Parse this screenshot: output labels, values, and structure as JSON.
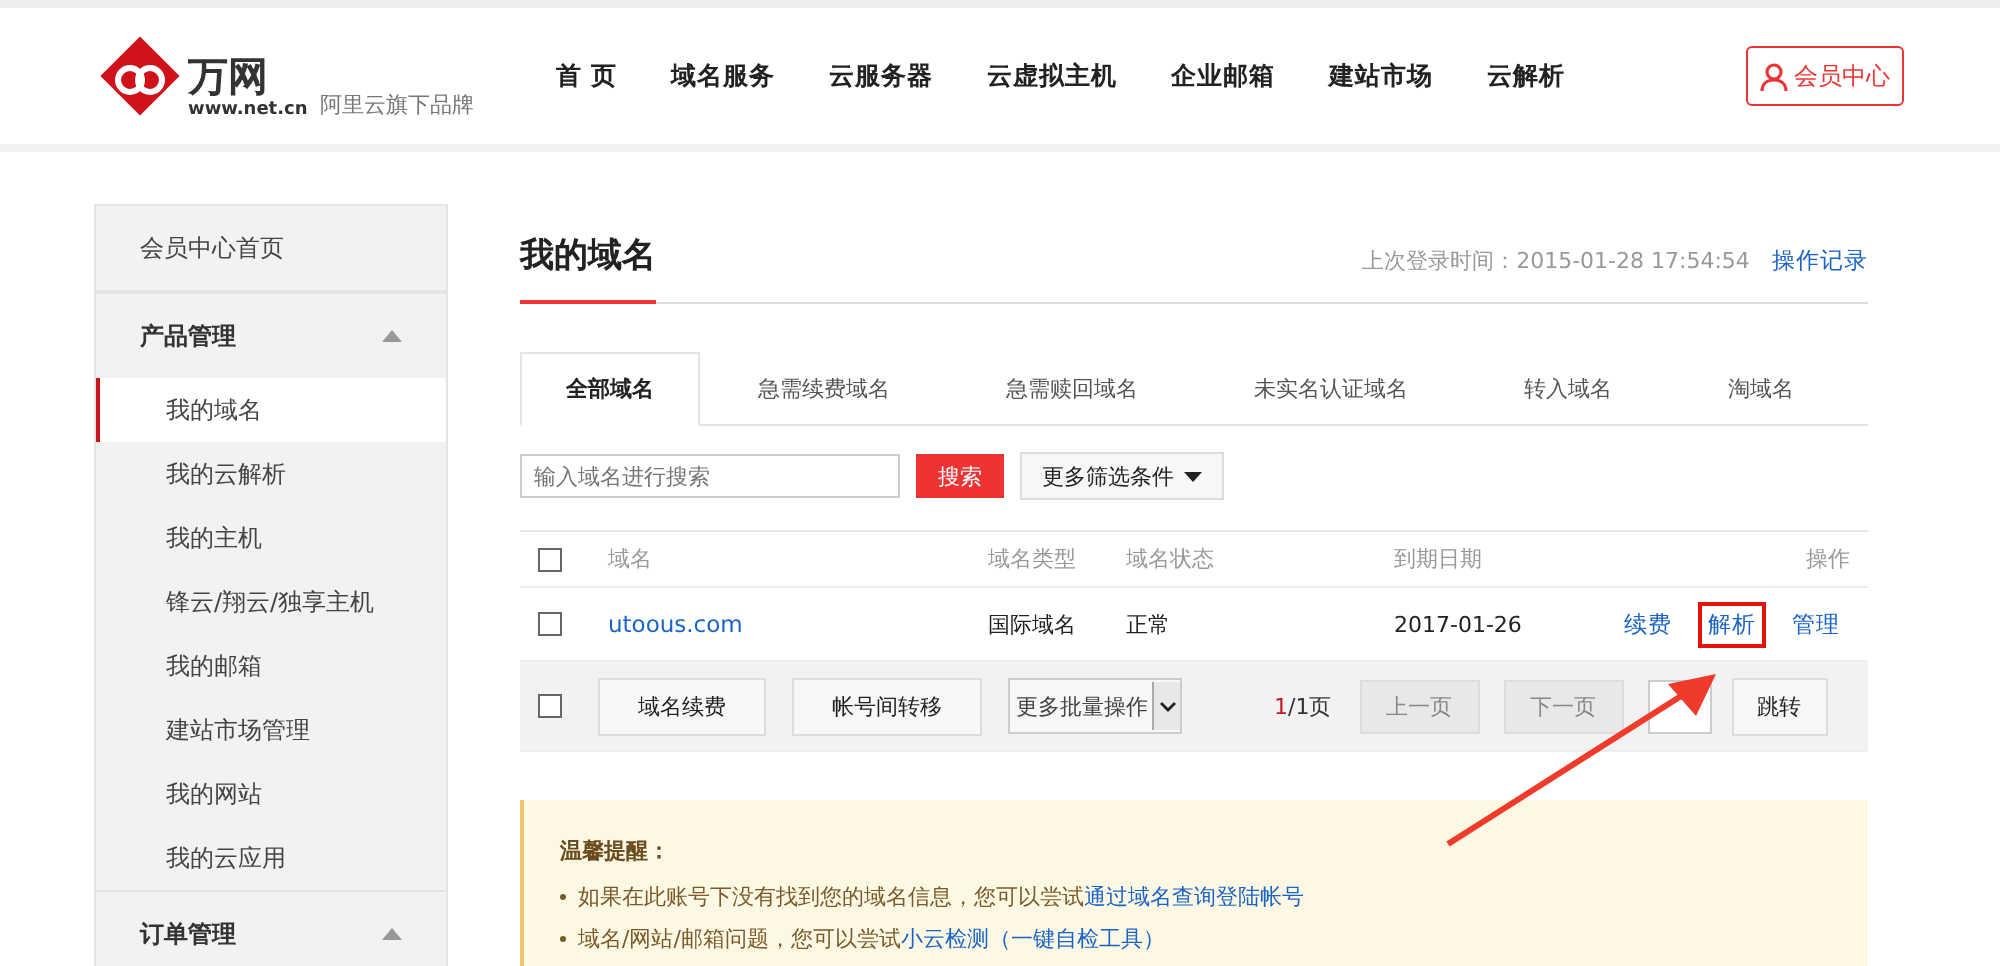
{
  "header": {
    "logo_name": "万网",
    "logo_url": "www.net.cn",
    "tagline": "阿里云旗下品牌",
    "nav": [
      {
        "label": "首 页"
      },
      {
        "label": "域名服务"
      },
      {
        "label": "云服务器"
      },
      {
        "label": "云虚拟主机"
      },
      {
        "label": "企业邮箱"
      },
      {
        "label": "建站市场"
      },
      {
        "label": "云解析"
      }
    ],
    "member_button": "会员中心"
  },
  "sidebar": {
    "items": [
      {
        "label": "会员中心首页",
        "kind": "link"
      },
      {
        "label": "产品管理",
        "kind": "group",
        "expanded": true,
        "children": [
          {
            "label": "我的域名",
            "selected": true
          },
          {
            "label": "我的云解析",
            "selected": false
          },
          {
            "label": "我的主机",
            "selected": false
          },
          {
            "label": "锋云/翔云/独享主机",
            "selected": false
          },
          {
            "label": "我的邮箱",
            "selected": false
          },
          {
            "label": "建站市场管理",
            "selected": false
          },
          {
            "label": "我的网站",
            "selected": false
          },
          {
            "label": "我的云应用",
            "selected": false
          }
        ]
      },
      {
        "label": "订单管理",
        "kind": "group",
        "expanded": true
      }
    ]
  },
  "main": {
    "title": "我的域名",
    "last_login": "上次登录时间：2015-01-28 17:54:54",
    "log_link": "操作记录",
    "tabs": [
      {
        "label": "全部域名",
        "selected": true
      },
      {
        "label": "急需续费域名",
        "selected": false
      },
      {
        "label": "急需赎回域名",
        "selected": false
      },
      {
        "label": "未实名认证域名",
        "selected": false
      },
      {
        "label": "转入域名",
        "selected": false
      },
      {
        "label": "淘域名",
        "selected": false
      }
    ],
    "search": {
      "placeholder": "输入域名进行搜索",
      "button": "搜索",
      "filter": "更多筛选条件"
    },
    "table": {
      "header_checked": false,
      "columns": [
        "域名",
        "域名类型",
        "域名状态",
        "到期日期",
        "操作"
      ],
      "rows": [
        {
          "checked": false,
          "domain": "utoous.com",
          "type": "国际域名",
          "status": "正常",
          "expiry": "2017-01-26",
          "actions": [
            {
              "label": "续费",
              "highlighted": false
            },
            {
              "label": "解析",
              "highlighted": true
            },
            {
              "label": "管理",
              "highlighted": false
            }
          ]
        }
      ]
    },
    "batch": {
      "checked": false,
      "buttons": [
        "域名续费",
        "帐号间转移"
      ],
      "select": "更多批量操作",
      "page_current": "1",
      "page_total": "/1页",
      "prev": "上一页",
      "next": "下一页",
      "jump": "跳转"
    },
    "notice": {
      "title": "温馨提醒：",
      "items": [
        {
          "text": "如果在此账号下没有找到您的域名信息，您可以尝试",
          "link": "通过域名查询登陆帐号"
        },
        {
          "text": "域名/网站/邮箱问题，您可以尝试",
          "link": "小云检测（一键自检工具）"
        }
      ]
    }
  }
}
